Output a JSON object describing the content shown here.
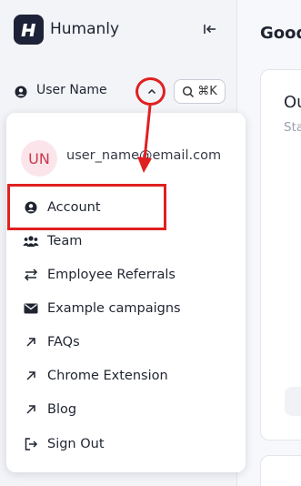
{
  "brand": {
    "name": "Humanly",
    "logo_icon": "humanly-logo-icon"
  },
  "sidebar": {
    "collapse_icon": "collapse-sidebar-icon",
    "user": {
      "name": "User Name",
      "icon": "user-circle-icon",
      "toggle_icon": "chevron-up-icon"
    },
    "shortcut": {
      "icon": "search-icon",
      "keys": "⌘K"
    }
  },
  "dropdown": {
    "avatar_initials": "UN",
    "email": "user_name@email.com",
    "items": [
      {
        "label": "Account",
        "icon": "user-circle-icon"
      },
      {
        "label": "Team",
        "icon": "team-icon"
      },
      {
        "label": "Employee Referrals",
        "icon": "swap-arrows-icon"
      },
      {
        "label": "Example campaigns",
        "icon": "envelope-icon"
      },
      {
        "label": "FAQs",
        "icon": "external-arrow-icon"
      },
      {
        "label": "Chrome Extension",
        "icon": "external-arrow-icon"
      },
      {
        "label": "Blog",
        "icon": "external-arrow-icon"
      },
      {
        "label": "Sign Out",
        "icon": "sign-out-icon"
      }
    ]
  },
  "main": {
    "greeting": "Good",
    "card": {
      "title": "Ou",
      "subtitle": "Sta"
    }
  },
  "colors": {
    "annotation_red": "#e02020",
    "sidebar_bg": "#f2f4f8",
    "logo_bg": "#1e2238",
    "avatar_bg": "#fbe5ea",
    "avatar_text": "#c8384f"
  }
}
